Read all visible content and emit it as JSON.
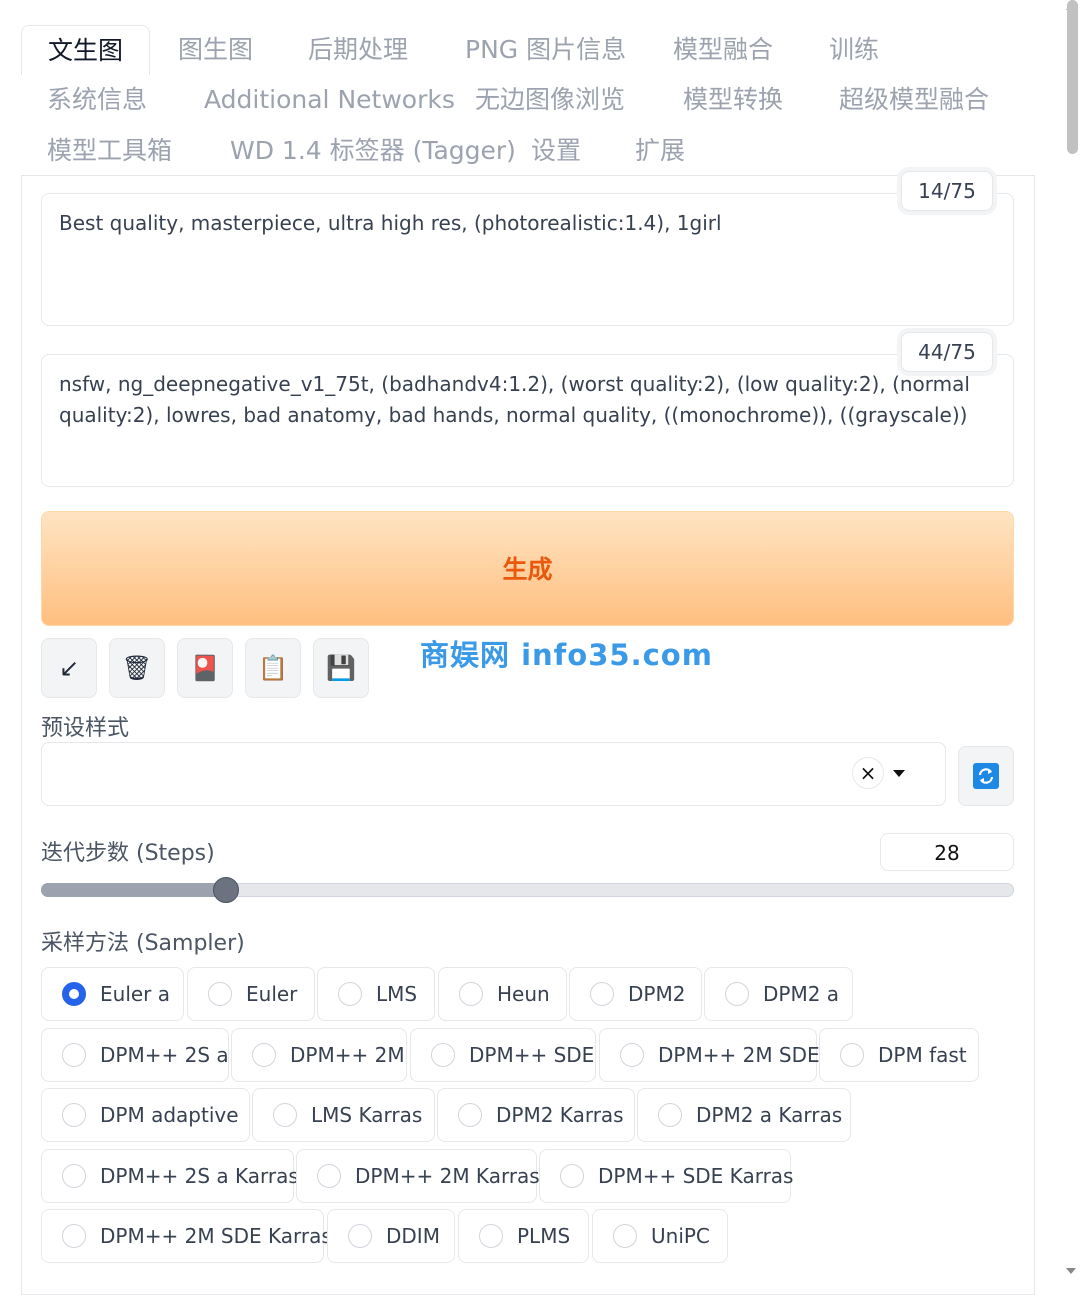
{
  "tabs": [
    {
      "label": "文生图",
      "active": true
    },
    {
      "label": "图生图"
    },
    {
      "label": "后期处理"
    },
    {
      "label": "PNG 图片信息"
    },
    {
      "label": "模型融合"
    },
    {
      "label": "训练"
    },
    {
      "label": "系统信息"
    },
    {
      "label": "Additional Networks"
    },
    {
      "label": "无边图像浏览"
    },
    {
      "label": "模型转换"
    },
    {
      "label": "超级模型融合"
    },
    {
      "label": "模型工具箱"
    },
    {
      "label": "WD 1.4 标签器 (Tagger)"
    },
    {
      "label": "设置"
    },
    {
      "label": "扩展"
    }
  ],
  "prompt": {
    "text": "Best quality, masterpiece, ultra high res, (photorealistic:1.4), 1girl",
    "token_count": "14/75"
  },
  "negative_prompt": {
    "text": "nsfw, ng_deepnegative_v1_75t, (badhandv4:1.2), (worst quality:2), (low quality:2), (normal quality:2), lowres, bad anatomy, bad hands, normal quality, ((monochrome)), ((grayscale))",
    "token_count": "44/75"
  },
  "generate_label": "生成",
  "tool_buttons": [
    {
      "icon": "arrow-down-left-icon",
      "glyph": "↙"
    },
    {
      "icon": "trash-icon",
      "glyph": "🗑"
    },
    {
      "icon": "red-card-icon",
      "glyph": "🎴"
    },
    {
      "icon": "clipboard-icon",
      "glyph": "📋"
    },
    {
      "icon": "floppy-disk-icon",
      "glyph": "💾"
    }
  ],
  "watermark": "商娱网 info35.com",
  "styles": {
    "label": "预设样式",
    "value": "",
    "clear_glyph": "×"
  },
  "steps": {
    "label": "迭代步数 (Steps)",
    "value": "28",
    "fraction": 0.19
  },
  "sampler": {
    "label": "采样方法 (Sampler)",
    "selected": "Euler a",
    "options": [
      "Euler a",
      "Euler",
      "LMS",
      "Heun",
      "DPM2",
      "DPM2 a",
      "DPM++ 2S a",
      "DPM++ 2M",
      "DPM++ SDE",
      "DPM++ 2M SDE",
      "DPM fast",
      "DPM adaptive",
      "LMS Karras",
      "DPM2 Karras",
      "DPM2 a Karras",
      "DPM++ 2S a Karras",
      "DPM++ 2M Karras",
      "DPM++ SDE Karras",
      "DPM++ 2M SDE Karras",
      "DDIM",
      "PLMS",
      "UniPC"
    ]
  },
  "colors": {
    "accent": "#2563eb",
    "generate_text": "#ea580c",
    "watermark": "#3b9ae8"
  }
}
